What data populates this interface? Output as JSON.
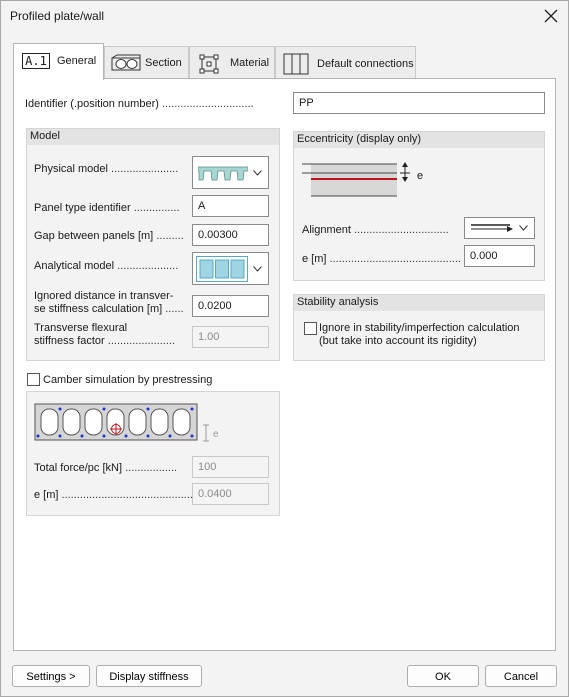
{
  "window": {
    "title": "Profiled plate/wall"
  },
  "tabs": [
    {
      "icon_text": "A.1",
      "label": "General"
    },
    {
      "label": "Section"
    },
    {
      "label": "Material"
    },
    {
      "label": "Default connections"
    }
  ],
  "identifier": {
    "label": "Identifier (.position number)",
    "dots": "..............................",
    "value": "PP"
  },
  "model": {
    "title": "Model",
    "physical_model_label": "Physical model",
    "physical_model_dots": "......................",
    "panel_type_label": "Panel type identifier",
    "panel_type_dots": "...............",
    "panel_type_value": "A",
    "gap_label": "Gap between panels [m]",
    "gap_dots": ".........",
    "gap_value": "0.00300",
    "analytical_label": "Analytical model",
    "analytical_dots": "....................",
    "ignored_label_1": "Ignored distance in transver-",
    "ignored_label_2": "se stiffness calculation [m]",
    "ignored_dots": "......",
    "ignored_value": "0.0200",
    "transverse_label_1": "Transverse flexural",
    "transverse_label_2": "stiffness factor",
    "transverse_dots": "......................",
    "transverse_value": "1.00"
  },
  "camber": {
    "checkbox_label": "Camber simulation by prestressing",
    "checked": false,
    "e_marker": "e",
    "total_force_label": "Total force/pc [kN]",
    "total_force_dots": ".................",
    "total_force_value": "100",
    "e_label": "e [m]",
    "e_dots": "..............................................",
    "e_value": "0.0400"
  },
  "eccentricity": {
    "title": "Eccentricity (display only)",
    "e_marker": "e",
    "alignment_label": "Alignment",
    "alignment_dots": "...............................",
    "e_label": "e [m]",
    "e_dots": "...........................................",
    "e_value": "0.000"
  },
  "stability": {
    "title": "Stability analysis",
    "checkbox_line1": "Ignore in stability/imperfection calculation",
    "checkbox_line2": "(but take into account its rigidity)",
    "checked": false
  },
  "buttons": {
    "settings": "Settings >",
    "display_stiffness": "Display stiffness",
    "ok": "OK",
    "cancel": "Cancel"
  },
  "colors": {
    "red_line": "#c0141c",
    "profile_fill": "#a6d6cf",
    "analytic_fill": "#9fd4e3",
    "strand_dot": "#1a33cc"
  }
}
